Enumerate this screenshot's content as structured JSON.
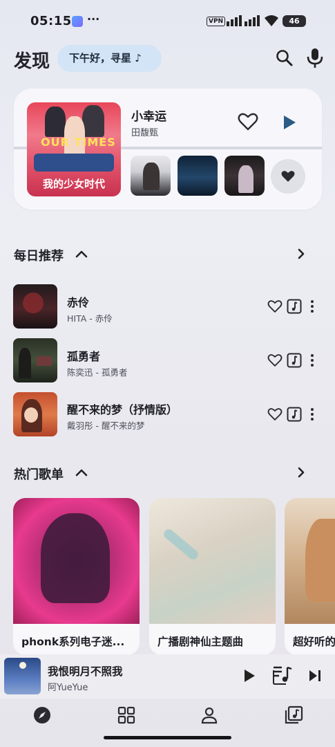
{
  "status_bar": {
    "time": "05:15",
    "dots": "···",
    "vpn": "VPN",
    "battery": "46",
    "icons": [
      "app-notification-icon",
      "signal-icon",
      "wifi-icon",
      "battery-icon"
    ]
  },
  "header": {
    "title": "发现",
    "greeting": "下午好，寻星 ♪",
    "icons": [
      "search-icon",
      "mic-icon"
    ]
  },
  "now_playing_card": {
    "cover_art_text": "我的少女时代",
    "cover_logo_text": "OUR TIMES",
    "title": "小幸运",
    "artist": "田馥甄",
    "icons": [
      "heart-outline-icon",
      "play-icon",
      "heart-filled-icon"
    ]
  },
  "daily_section": {
    "title": "每日推荐",
    "songs": [
      {
        "title": "赤伶",
        "subtitle": "HITA - 赤伶"
      },
      {
        "title": "孤勇者",
        "subtitle": "陈奕迅 - 孤勇者"
      },
      {
        "title": "醒不来的梦（抒情版）",
        "subtitle": "戴羽彤 - 醒不来的梦"
      }
    ],
    "icons": [
      "chevron-up-icon",
      "chevron-right-icon",
      "heart-outline-icon",
      "lyrics-icon",
      "more-vertical-icon"
    ]
  },
  "playlist_section": {
    "title": "热门歌单",
    "playlists": [
      {
        "label": "phonk系列电子迷..."
      },
      {
        "label": "广播剧神仙主题曲"
      },
      {
        "label": "超好听的"
      }
    ]
  },
  "mini_player": {
    "title": "我恨明月不照我",
    "artist": "阿YueYue",
    "icons": [
      "play-icon",
      "queue-music-icon",
      "skip-next-icon"
    ]
  },
  "bottom_nav": {
    "items": [
      "discover-icon",
      "grid-icon",
      "profile-icon",
      "library-icon"
    ]
  },
  "colors": {
    "background": "#e9eaf0",
    "card": "#f7f7fb",
    "greeting_chip": "#d3e4f6",
    "accent_play": "#2b5c86",
    "text_primary": "#1c1c22"
  }
}
